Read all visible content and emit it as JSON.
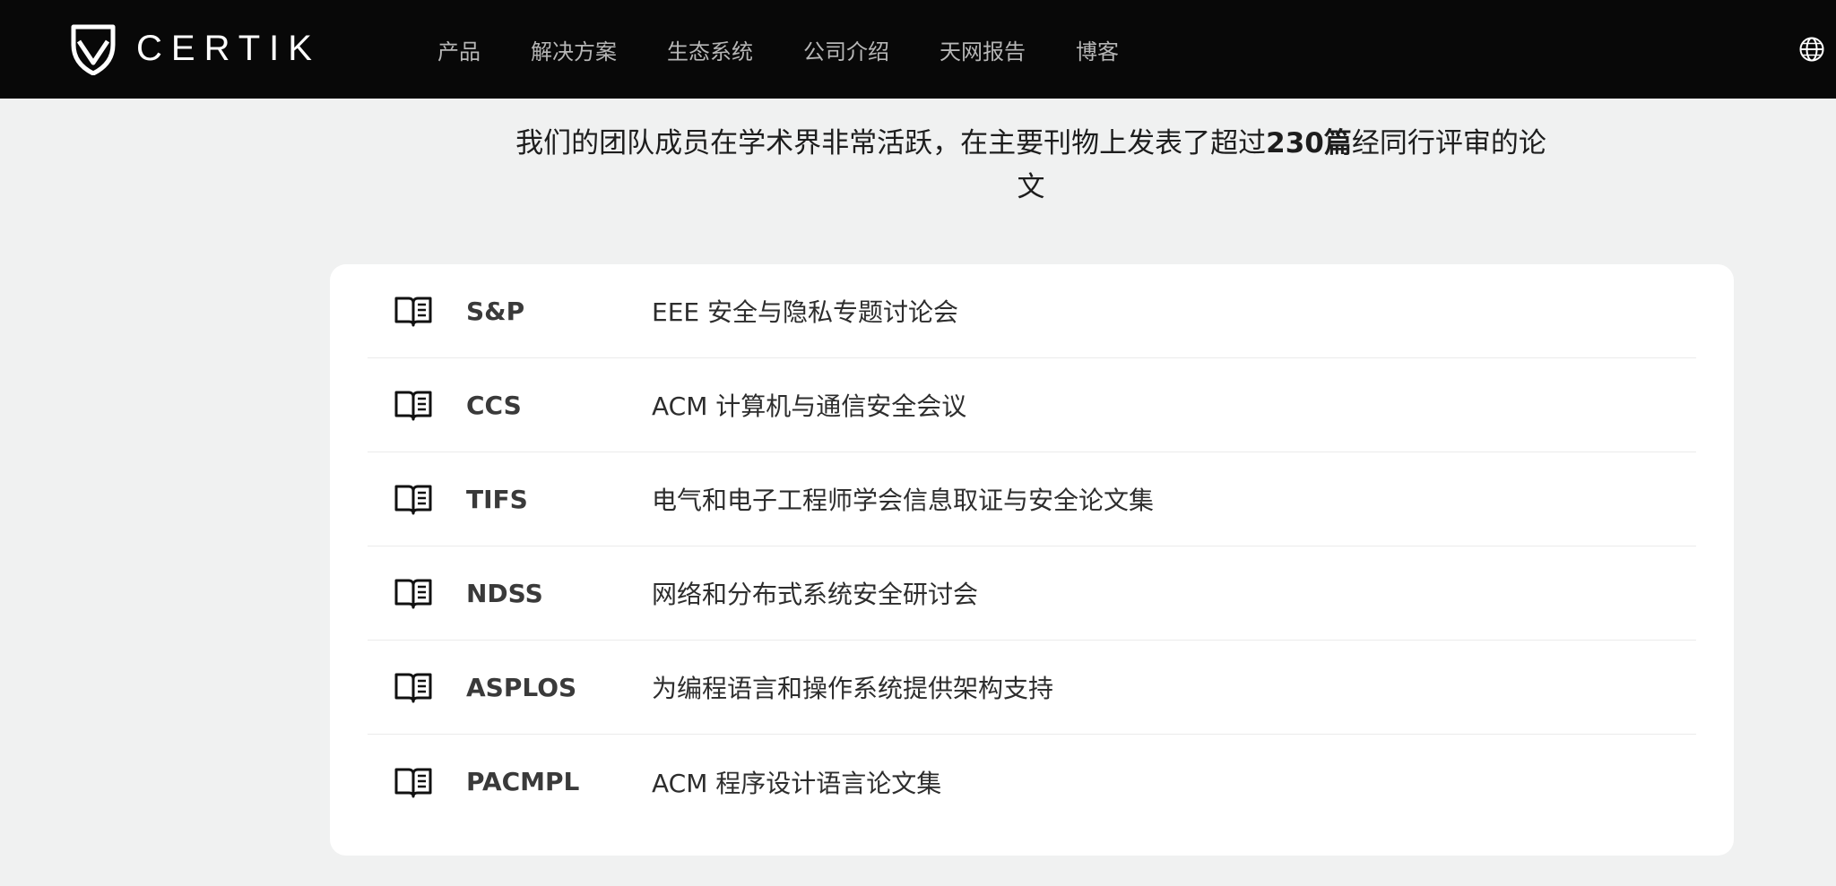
{
  "header": {
    "logo_text": "CERTIK",
    "nav": [
      "产品",
      "解决方案",
      "生态系统",
      "公司介绍",
      "天网报告",
      "博客"
    ],
    "language_icon": "globe-icon"
  },
  "intro": {
    "before": "我们的团队成员在学术界非常活跃，在主要刊物上发表了超过",
    "highlight": "230篇",
    "after": "经同行评审的论文"
  },
  "publications": [
    {
      "abbr": "S&P",
      "name": "EEE 安全与隐私专题讨论会",
      "icon": "open-book-icon"
    },
    {
      "abbr": "CCS",
      "name": "ACM 计算机与通信安全会议",
      "icon": "open-book-icon"
    },
    {
      "abbr": "TIFS",
      "name": "电气和电子工程师学会信息取证与安全论文集",
      "icon": "open-book-icon"
    },
    {
      "abbr": "NDSS",
      "name": "网络和分布式系统安全研讨会",
      "icon": "open-book-icon"
    },
    {
      "abbr": "ASPLOS",
      "name": "为编程语言和操作系统提供架构支持",
      "icon": "open-book-icon"
    },
    {
      "abbr": "PACMPL",
      "name": "ACM 程序设计语言论文集",
      "icon": "open-book-icon"
    }
  ]
}
